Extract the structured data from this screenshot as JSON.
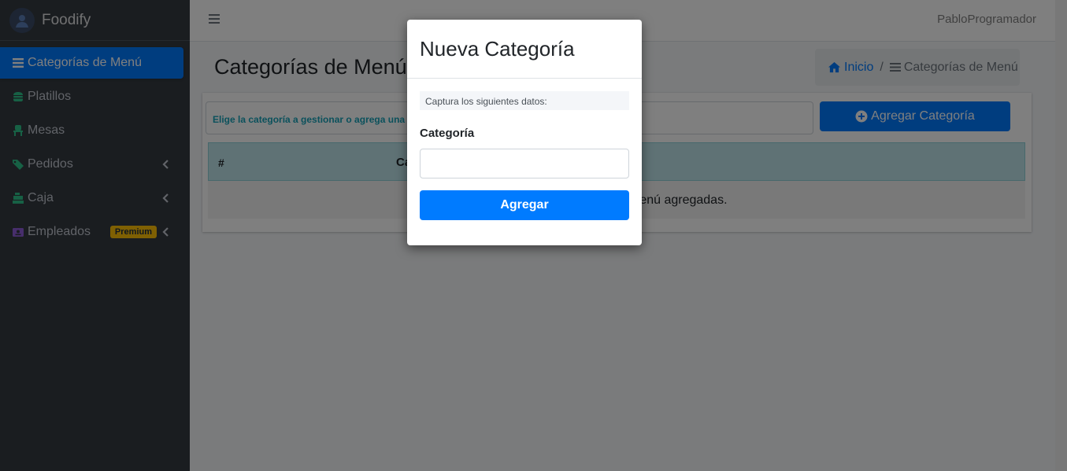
{
  "app": {
    "name": "Foodify"
  },
  "sidebar": {
    "items": [
      {
        "label": "Categorías de Menú",
        "icon": "list-icon",
        "active": true
      },
      {
        "label": "Platillos",
        "icon": "hamburger-food-icon"
      },
      {
        "label": "Mesas",
        "icon": "chair-icon"
      },
      {
        "label": "Pedidos",
        "icon": "tags-icon",
        "expandable": true
      },
      {
        "label": "Caja",
        "icon": "cash-register-icon",
        "expandable": true
      },
      {
        "label": "Empleados",
        "icon": "id-card-icon",
        "expandable": true,
        "badge": "Premium"
      }
    ]
  },
  "topbar": {
    "user": "PabloProgramador"
  },
  "content": {
    "title": "Categorías de Menú",
    "breadcrumb": {
      "home": "Inicio",
      "current": "Categorías de Menú"
    },
    "hint": "Elige la categoría a gestionar o agrega una nueva",
    "add_button": "Agregar Categoría",
    "table": {
      "columns": [
        "#",
        "Categoría"
      ],
      "empty_text": "No hay categorías de menú agregadas."
    }
  },
  "modal": {
    "title": "Nueva Categoría",
    "hint": "Captura los siguientes datos:",
    "field_label": "Categoría",
    "field_value": "",
    "submit": "Agregar"
  },
  "colors": {
    "primary": "#007bff",
    "sidebar": "#343a40",
    "info": "#17a2b8",
    "warning": "#ffc107"
  }
}
